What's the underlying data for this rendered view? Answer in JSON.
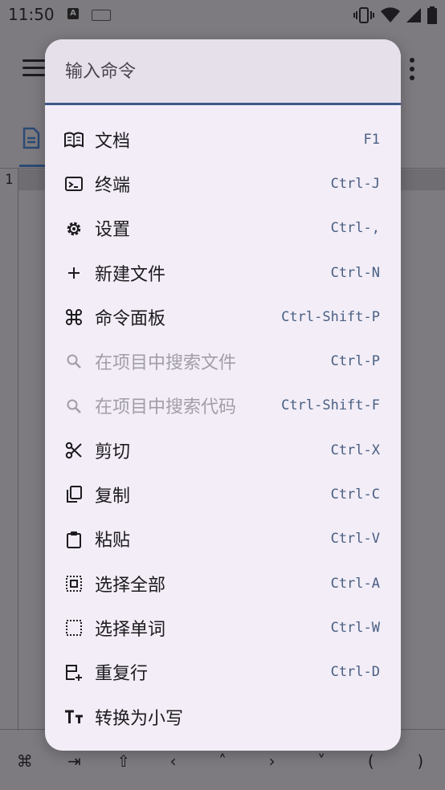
{
  "status_bar": {
    "time": "11:50",
    "app_badge": "A"
  },
  "editor": {
    "line_number": "1"
  },
  "keybar": [
    "⌘",
    "⇥",
    "⇧",
    "‹",
    "˄",
    "›",
    "˅",
    "(",
    ")"
  ],
  "palette": {
    "search_placeholder": "输入命令",
    "commands": [
      {
        "icon": "book-open-icon",
        "label": "文档",
        "shortcut": "F1",
        "enabled": true
      },
      {
        "icon": "terminal-icon",
        "label": "终端",
        "shortcut": "Ctrl-J",
        "enabled": true
      },
      {
        "icon": "gear-icon",
        "label": "设置",
        "shortcut": "Ctrl-,",
        "enabled": true
      },
      {
        "icon": "plus-icon",
        "label": "新建文件",
        "shortcut": "Ctrl-N",
        "enabled": true
      },
      {
        "icon": "command-icon",
        "label": "命令面板",
        "shortcut": "Ctrl-Shift-P",
        "enabled": true
      },
      {
        "icon": "search-icon",
        "label": "在项目中搜索文件",
        "shortcut": "Ctrl-P",
        "enabled": false
      },
      {
        "icon": "search-icon",
        "label": "在项目中搜索代码",
        "shortcut": "Ctrl-Shift-F",
        "enabled": false
      },
      {
        "icon": "scissors-icon",
        "label": "剪切",
        "shortcut": "Ctrl-X",
        "enabled": true
      },
      {
        "icon": "copy-icon",
        "label": "复制",
        "shortcut": "Ctrl-C",
        "enabled": true
      },
      {
        "icon": "clipboard-icon",
        "label": "粘贴",
        "shortcut": "Ctrl-V",
        "enabled": true
      },
      {
        "icon": "select-all-icon",
        "label": "选择全部",
        "shortcut": "Ctrl-A",
        "enabled": true
      },
      {
        "icon": "select-word-icon",
        "label": "选择单词",
        "shortcut": "Ctrl-W",
        "enabled": true
      },
      {
        "icon": "duplicate-line-icon",
        "label": "重复行",
        "shortcut": "Ctrl-D",
        "enabled": true
      },
      {
        "icon": "text-case-icon",
        "label": "转换为小写",
        "shortcut": "",
        "enabled": true
      }
    ]
  },
  "colors": {
    "scrim": "#7d7b7f",
    "palette_bg": "#f2edf6",
    "accent": "#3c5a8a",
    "shortcut": "#4a5f84"
  }
}
